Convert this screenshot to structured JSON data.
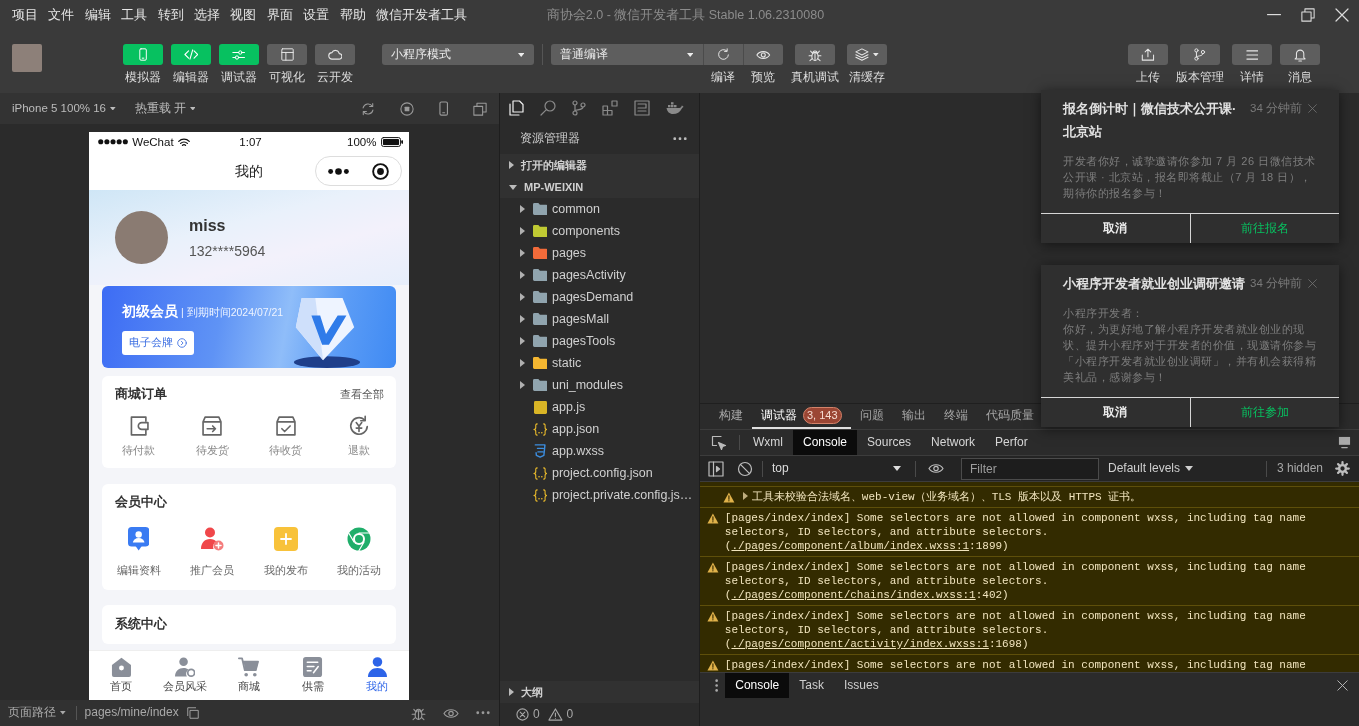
{
  "window": {
    "title": "商协会2.0 - 微信开发者工具 Stable 1.06.2310080"
  },
  "menu": [
    "项目",
    "文件",
    "编辑",
    "工具",
    "转到",
    "选择",
    "视图",
    "界面",
    "设置",
    "帮助",
    "微信开发者工具"
  ],
  "toolbar": {
    "views": [
      {
        "label": "模拟器",
        "on": true
      },
      {
        "label": "编辑器",
        "on": true
      },
      {
        "label": "调试器",
        "on": true
      },
      {
        "label": "可视化",
        "on": false
      },
      {
        "label": "云开发",
        "on": false
      }
    ],
    "mode": "小程序模式",
    "compile": "普通编译",
    "actions": [
      "编译",
      "预览",
      "真机调试",
      "清缓存"
    ],
    "right_actions": [
      "上传",
      "版本管理",
      "详情",
      "消息"
    ]
  },
  "simulator": {
    "device": "iPhone 5 100% 16",
    "hot_reload": "热重载 开",
    "phone": {
      "carrier": "WeChat",
      "time": "1:07",
      "battery": "100%",
      "title": "我的",
      "user": {
        "name": "miss",
        "phone": "132****5964"
      },
      "membership": {
        "level": "初级会员",
        "expiry": "| 到期时间2024/07/21",
        "button": "电子会牌"
      },
      "sections": [
        {
          "title": "商城订单",
          "link": "查看全部",
          "items": [
            "待付款",
            "待发货",
            "待收货",
            "退款"
          ]
        },
        {
          "title": "会员中心",
          "items": [
            "编辑资料",
            "推广会员",
            "我的发布",
            "我的活动"
          ]
        },
        {
          "title": "系统中心"
        }
      ],
      "tabs": [
        {
          "label": "首页",
          "selected": false
        },
        {
          "label": "会员风采",
          "selected": false
        },
        {
          "label": "商城",
          "selected": false
        },
        {
          "label": "供需",
          "selected": false
        },
        {
          "label": "我的",
          "selected": true
        }
      ]
    },
    "path_label": "页面路径",
    "path": "pages/mine/index"
  },
  "explorer": {
    "activity": [
      {
        "selected": true
      },
      {
        "selected": false
      },
      {
        "selected": false
      },
      {
        "selected": false
      },
      {
        "selected": false
      },
      {
        "selected": false
      }
    ],
    "title": "资源管理器",
    "sections": [
      {
        "label": "打开的编辑器",
        "expanded": false
      },
      {
        "label": "MP-WEIXIN",
        "expanded": true,
        "children": [
          {
            "label": "common",
            "kind": "folder",
            "color": "#90a4ae",
            "expanded": false
          },
          {
            "label": "components",
            "kind": "folder",
            "color": "#c0ca33",
            "expanded": false
          },
          {
            "label": "pages",
            "kind": "folder",
            "color": "#f26b3a",
            "expanded": false
          },
          {
            "label": "pagesActivity",
            "kind": "folder",
            "color": "#90a4ae",
            "expanded": false
          },
          {
            "label": "pagesDemand",
            "kind": "folder",
            "color": "#90a4ae",
            "expanded": false
          },
          {
            "label": "pagesMall",
            "kind": "folder",
            "color": "#90a4ae",
            "expanded": false
          },
          {
            "label": "pagesTools",
            "kind": "folder",
            "color": "#90a4ae",
            "expanded": false
          },
          {
            "label": "static",
            "kind": "folder",
            "color": "#f5b731",
            "expanded": false
          },
          {
            "label": "uni_modules",
            "kind": "folder",
            "color": "#90a4ae",
            "expanded": false
          },
          {
            "label": "app.js",
            "kind": "js"
          },
          {
            "label": "app.json",
            "kind": "json"
          },
          {
            "label": "app.wxss",
            "kind": "wxss"
          },
          {
            "label": "project.config.json",
            "kind": "json"
          },
          {
            "label": "project.private.config.js…",
            "kind": "json"
          }
        ]
      }
    ],
    "outline": {
      "label": "大纲",
      "expanded": false
    },
    "errors": "0",
    "warnings": "0"
  },
  "debugger": {
    "tabs": [
      {
        "label": "构建",
        "selected": false
      },
      {
        "label": "调试器",
        "selected": true,
        "badge": "3, 143"
      },
      {
        "label": "问题",
        "selected": false
      },
      {
        "label": "输出",
        "selected": false
      },
      {
        "label": "终端",
        "selected": false
      },
      {
        "label": "代码质量",
        "selected": false
      }
    ],
    "devtools_tabs": [
      {
        "label": "Wxml",
        "selected": false
      },
      {
        "label": "Console",
        "selected": true
      },
      {
        "label": "Sources",
        "selected": false
      },
      {
        "label": "Network",
        "selected": false
      },
      {
        "label": "Perfor",
        "selected": false
      }
    ],
    "console": {
      "context": "top",
      "filter": {
        "placeholder": "Filter"
      },
      "levels": "Default levels",
      "hidden": "3 hidden",
      "messages": [
        {
          "kind": "group",
          "expanded": false,
          "text": "工具未校验合法域名、web-view（业务域名）、TLS 版本以及 HTTPS 证书。"
        },
        {
          "kind": "warning",
          "text": "[pages/index/index] Some selectors are not allowed in component wxss, including tag name selectors, ID selectors, and attribute selectors.(",
          "link": "./pages/component/album/index.wxss:1",
          "suffix": ":1899)"
        },
        {
          "kind": "warning",
          "text": "[pages/index/index] Some selectors are not allowed in component wxss, including tag name selectors, ID selectors, and attribute selectors.(",
          "link": "./pages/component/chains/index.wxss:1",
          "suffix": ":402)"
        },
        {
          "kind": "warning",
          "text": "[pages/index/index] Some selectors are not allowed in component wxss, including tag name selectors, ID selectors, and attribute selectors.(",
          "link": "./pages/component/activity/index.wxss:1",
          "suffix": ":1698)"
        },
        {
          "kind": "warning",
          "text": "[pages/index/index] Some selectors are not allowed in component wxss, including tag name"
        }
      ]
    },
    "drawer_tabs": [
      {
        "label": "Console",
        "selected": true
      },
      {
        "label": "Task",
        "selected": false
      },
      {
        "label": "Issues",
        "selected": false
      }
    ]
  },
  "notifications": [
    {
      "title": "报名倒计时｜微信技术公开课·北京站",
      "time": "34 分钟前",
      "body": [
        "开发者你好，诚挚邀请你参加 7 月 26 日微信技术公开课 · 北京站，报名即将截止（7 月 18 日），期待你的报名参与！"
      ],
      "actions": [
        {
          "label": "取消",
          "kind": "cancel"
        },
        {
          "label": "前往报名",
          "kind": "confirm"
        }
      ]
    },
    {
      "title": "小程序开发者就业创业调研邀请",
      "time": "34 分钟前",
      "body": [
        "小程序开发者：",
        "你好，为更好地了解小程序开发者就业创业的现状、提升小程序对于开发者的价值，现邀请你参与「小程序开发者就业创业调研」，并有机会获得精美礼品，感谢参与！"
      ],
      "actions": [
        {
          "label": "取消",
          "kind": "cancel"
        },
        {
          "label": "前往参加",
          "kind": "confirm"
        }
      ]
    }
  ]
}
